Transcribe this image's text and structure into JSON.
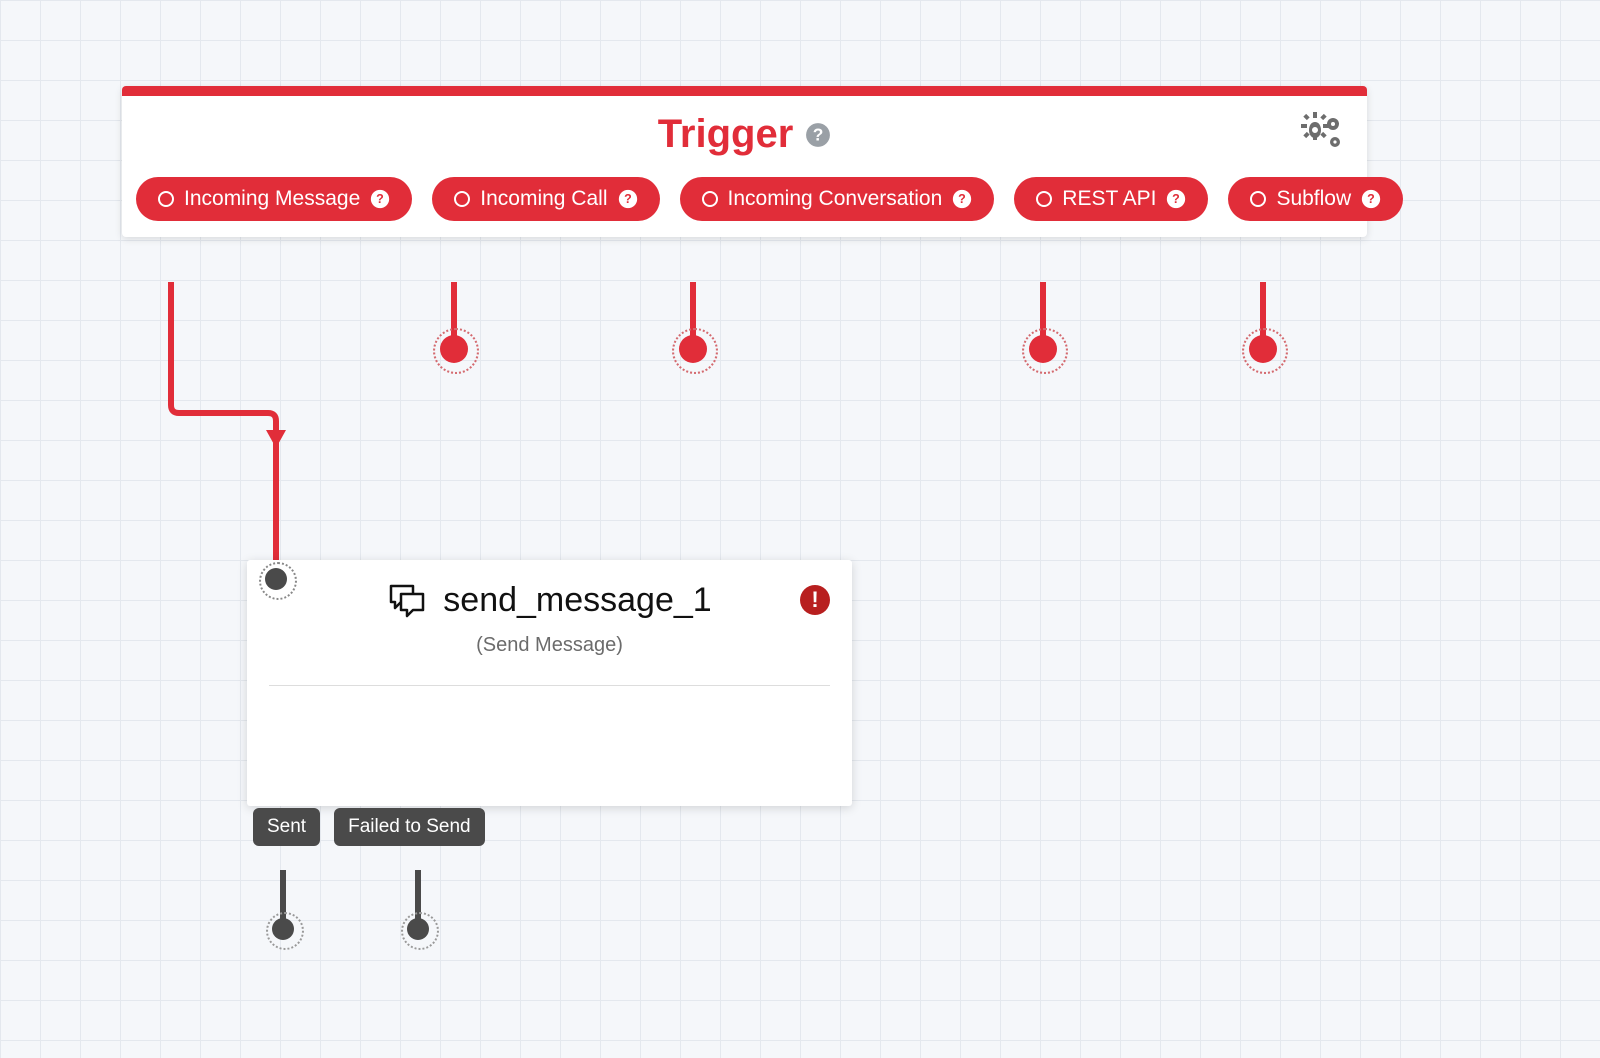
{
  "trigger": {
    "title": "Trigger",
    "outputs": [
      {
        "label": "Incoming Message"
      },
      {
        "label": "Incoming Call"
      },
      {
        "label": "Incoming Conversation"
      },
      {
        "label": "REST API"
      },
      {
        "label": "Subflow"
      }
    ]
  },
  "widget": {
    "name": "send_message_1",
    "type_label": "(Send Message)",
    "has_error": true,
    "outputs": [
      {
        "label": "Sent"
      },
      {
        "label": "Failed to Send"
      }
    ]
  },
  "colors": {
    "accent": "#e12d39",
    "node_grey": "#4a4a4a"
  }
}
